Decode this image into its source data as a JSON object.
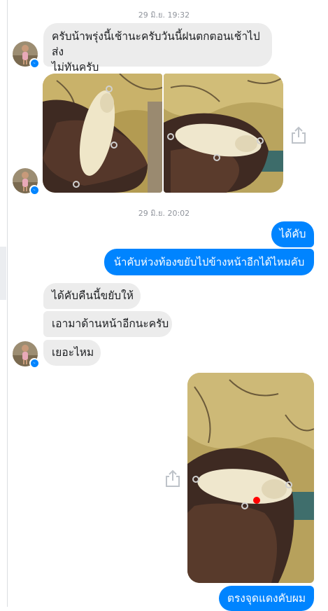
{
  "thread": {
    "timestamp_1": "29 มิ.ย. 19:32",
    "timestamp_2": "29 มิ.ย. 20:02"
  },
  "messages": {
    "in_1_line1": "ครับน้าพรุ่งนี้เช้านะครับวันนี้ฝนตกตอนเช้าไปส่ง",
    "in_1_line2": "ไม่ทันครับ",
    "out_1": "ได้คับ",
    "out_2": "น้าคับห่วงท้องขยับไปข้างหน้าอีกได้ไหมคับ",
    "in_2": "ได้คับคืนนี้ขยับให้",
    "in_3": "เอามาด้านหน้าอีกนะครับ",
    "in_4": "เยอะไหม",
    "out_3": "ตรงจุดแดงคับผม"
  },
  "icons": {
    "share": "share-icon",
    "messenger_badge": "messenger-icon"
  },
  "colors": {
    "outgoing_bubble": "#0084ff",
    "incoming_bubble": "#ececec",
    "timestamp_text": "#90949c",
    "red_marker": "#ff0000"
  }
}
